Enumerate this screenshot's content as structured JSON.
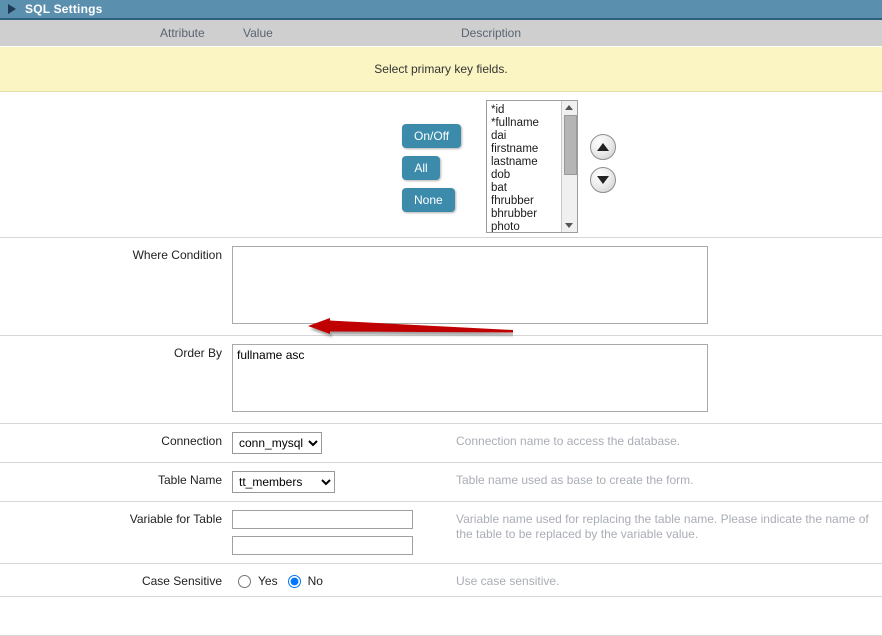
{
  "titlebar": {
    "title": "SQL Settings",
    "toggle_icon": "triangle-right-icon"
  },
  "columns": {
    "attribute": "Attribute",
    "value": "Value",
    "description": "Description"
  },
  "notice": {
    "text": "Select primary key fields."
  },
  "selector": {
    "buttons": [
      {
        "label": "On/Off",
        "name": "onoff-button"
      },
      {
        "label": "All",
        "name": "all-button"
      },
      {
        "label": "None",
        "name": "none-button"
      }
    ],
    "fields": [
      "*id",
      "*fullname",
      " dai",
      " firstname",
      " lastname",
      " dob",
      " bat",
      " fhrubber",
      " bhrubber",
      " photo"
    ],
    "move_up_icon": "arrow-up-icon",
    "move_down_icon": "arrow-down-icon"
  },
  "rows": {
    "where_condition": {
      "label": "Where Condition",
      "value": "",
      "description": ""
    },
    "order_by": {
      "label": "Order By",
      "value": "fullname asc",
      "description": ""
    },
    "connection": {
      "label": "Connection",
      "value": "conn_mysql",
      "options": [
        "conn_mysql"
      ],
      "description": "Connection name to access the database."
    },
    "table_name": {
      "label": "Table Name",
      "value": "tt_members",
      "options": [
        "tt_members"
      ],
      "description": "Table name used as base to create the form."
    },
    "variable_for_table": {
      "label": "Variable for Table",
      "value1": "",
      "value2": "",
      "description": "Variable name used for replacing the table name. Please indicate the name of the table to be replaced by the variable value."
    },
    "case_sensitive": {
      "label": "Case Sensitive",
      "yes_label": "Yes",
      "no_label": "No",
      "selected": "No",
      "description": "Use case sensitive."
    }
  },
  "annotation": {
    "type": "red-arrow",
    "color": "#c00000",
    "points_at": "fullname asc"
  },
  "colors": {
    "titlebar_bg": "#5b8fae",
    "header_bg": "#cfcfcf",
    "notice_bg": "#faf5c3",
    "button_teal": "#3d8bab",
    "description_text": "#a9adb5"
  }
}
